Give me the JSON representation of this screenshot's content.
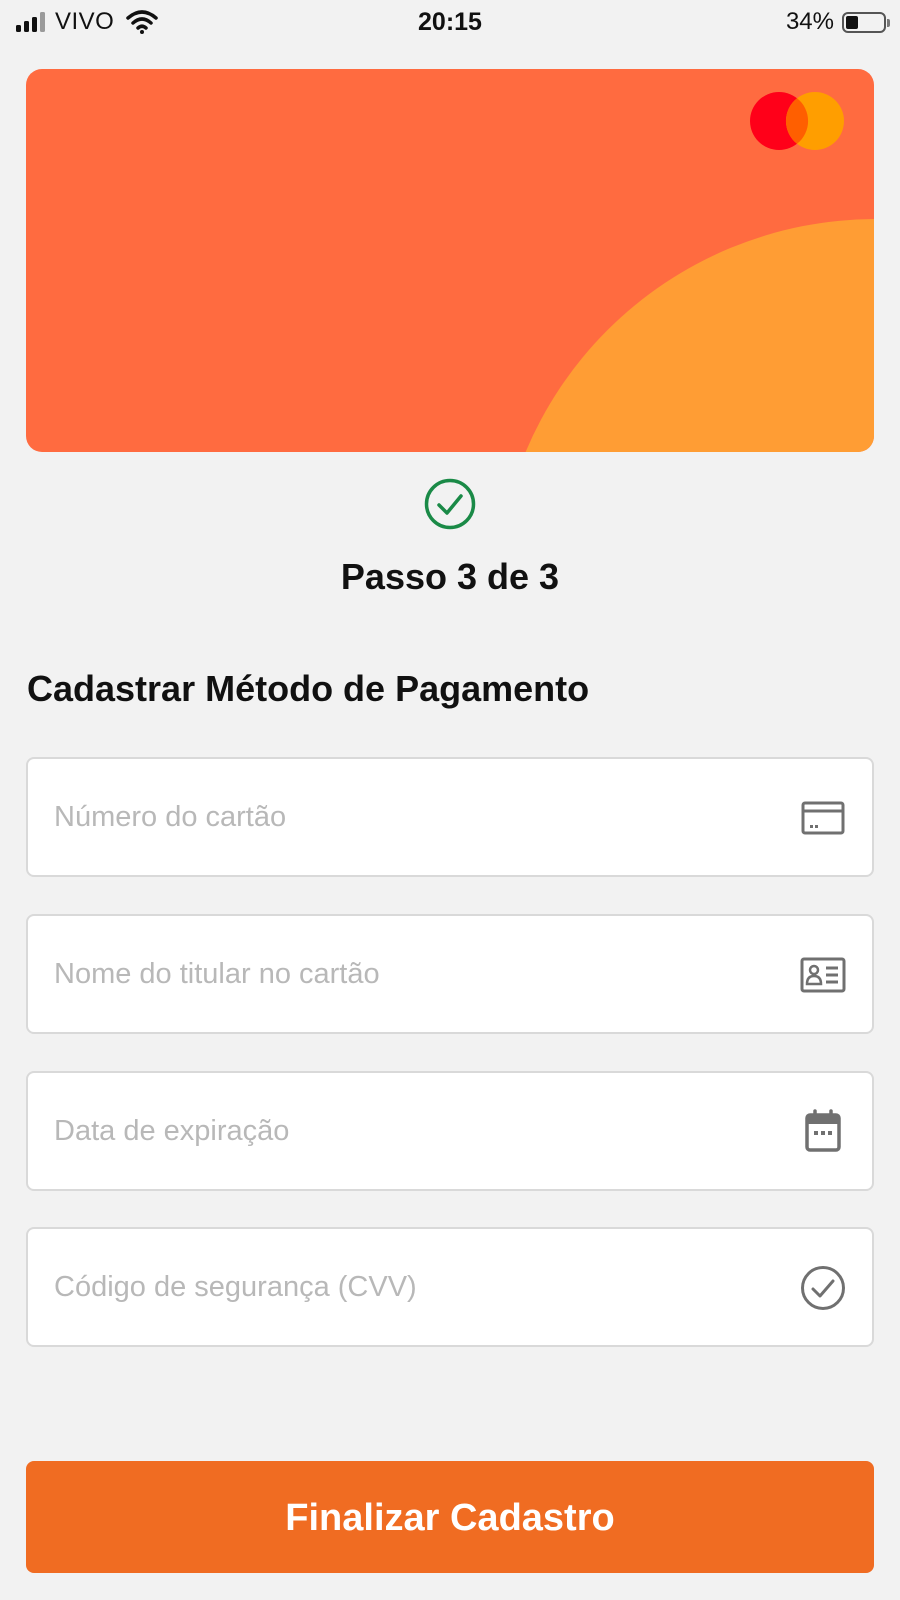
{
  "status_bar": {
    "carrier": "VIVO",
    "time": "20:15",
    "battery_percent": "34%",
    "battery_level": 0.34,
    "signal_bars": 3,
    "signal_bars_total": 4,
    "icons": [
      "signal-icon",
      "wifi-icon",
      "battery-icon"
    ]
  },
  "card": {
    "colors": {
      "base": "#ff6b40",
      "arc": "#ff9d34"
    },
    "brand_icon": "mastercard-logo",
    "brand_colors": {
      "left": "#ff0019",
      "right": "#ff9e00",
      "overlap": "#ff5f00"
    }
  },
  "step": {
    "icon": "check-circle-icon",
    "icon_color": "#1a8a47",
    "label": "Passo 3 de 3"
  },
  "form": {
    "title": "Cadastrar Método de Pagamento",
    "fields": [
      {
        "placeholder": "Número do cartão",
        "value": "",
        "icon": "credit-card-icon"
      },
      {
        "placeholder": "Nome do titular no cartão",
        "value": "",
        "icon": "id-card-icon"
      },
      {
        "placeholder": "Data de expiração",
        "value": "",
        "icon": "calendar-icon"
      },
      {
        "placeholder": "Código de segurança (CVV)",
        "value": "",
        "icon": "check-circle-icon"
      }
    ],
    "submit_label": "Finalizar Cadastro",
    "submit_color": "#f06c22"
  }
}
